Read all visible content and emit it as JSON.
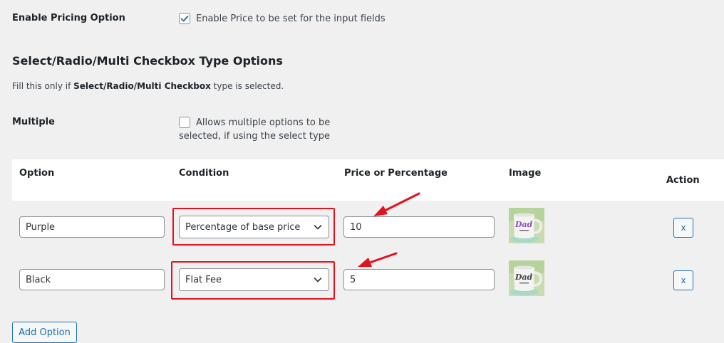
{
  "pricing": {
    "label": "Enable Pricing Option",
    "checkbox_label": "Enable Price to be set for the input fields",
    "checked": true
  },
  "section": {
    "title": "Select/Radio/Multi Checkbox Type Options",
    "hint_prefix": "Fill this only if ",
    "hint_bold": "Select/Radio/Multi Checkbox",
    "hint_suffix": " type is selected."
  },
  "multiple": {
    "label": "Multiple",
    "line1": "Allows multiple options to be",
    "line2": "selected, if using the select type",
    "checked": false
  },
  "table": {
    "headers": {
      "option": "Option",
      "condition": "Condition",
      "price": "Price or Percentage",
      "image": "Image",
      "action": "Action"
    },
    "rows": [
      {
        "option": "Purple",
        "condition": "Percentage of base price",
        "price": "10",
        "remove": "x",
        "mug_text_color": "#8a4fc2"
      },
      {
        "option": "Black",
        "condition": "Flat Fee",
        "price": "5",
        "remove": "x",
        "mug_text_color": "#444444"
      }
    ]
  },
  "add_button": "Add Option",
  "colors": {
    "accent": "#2271b1",
    "highlight": "#e3121c",
    "background": "#f0f0f1"
  }
}
